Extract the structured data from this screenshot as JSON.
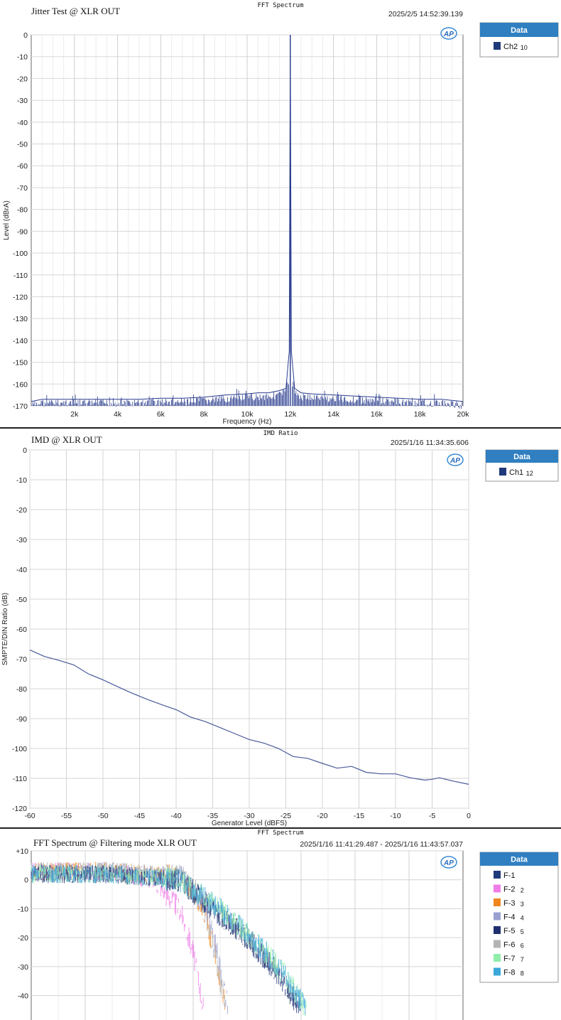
{
  "colors": {
    "trace_navy": "#2a3d8f",
    "imd_line": "#4a5a9a",
    "legend_header": "#2f7fc1",
    "grid": "#d4d4d4"
  },
  "chart_data": [
    {
      "type": "line",
      "window_title": "FFT Spectrum",
      "title": "Jitter Test @ XLR OUT",
      "timestamp": "2025/2/5 14:52:39.139",
      "xlabel": "Frequency (Hz)",
      "ylabel": "Level (dBrA)",
      "xlim": [
        0,
        20000
      ],
      "ylim": [
        -170,
        0
      ],
      "x_ticks": [
        "2k",
        "4k",
        "6k",
        "8k",
        "10k",
        "12k",
        "14k",
        "16k",
        "18k",
        "20k"
      ],
      "x_tick_values": [
        2000,
        4000,
        6000,
        8000,
        10000,
        12000,
        14000,
        16000,
        18000,
        20000
      ],
      "y_ticks": [
        "0",
        "-10",
        "-20",
        "-30",
        "-40",
        "-50",
        "-60",
        "-70",
        "-80",
        "-90",
        "-100",
        "-110",
        "-120",
        "-130",
        "-140",
        "-150",
        "-160",
        "-170"
      ],
      "grid": true,
      "legend_position": "right",
      "legend": {
        "header": "Data",
        "items": [
          {
            "name": "Ch2",
            "index": "10",
            "color": "#1f3a7a"
          }
        ]
      },
      "series": [
        {
          "name": "Ch2",
          "x": [
            0,
            500,
            1000,
            2000,
            3000,
            4000,
            5000,
            6000,
            7000,
            8000,
            9000,
            10000,
            10500,
            11000,
            11500,
            11800,
            11950,
            12000,
            12050,
            12200,
            12500,
            13000,
            14000,
            15000,
            16000,
            17000,
            18000,
            19000,
            20000
          ],
          "y": [
            -168,
            -167,
            -167,
            -167,
            -167,
            -167,
            -167,
            -166.5,
            -166.5,
            -166,
            -165,
            -164.5,
            -164,
            -164,
            -163,
            -162,
            -145,
            0,
            -145,
            -162,
            -164,
            -164.5,
            -165,
            -165.5,
            -166,
            -166.5,
            -167,
            -167,
            -168
          ]
        }
      ],
      "peak": {
        "x": 12000,
        "y": 0
      }
    },
    {
      "type": "line",
      "window_title": "IMD Ratio",
      "title": "IMD @ XLR OUT",
      "timestamp": "2025/1/16 11:34:35.606",
      "xlabel": "Generator Level (dBFS)",
      "ylabel": "SMPTE/DIN Ratio (dB)",
      "xlim": [
        -60,
        0
      ],
      "ylim": [
        -120,
        0
      ],
      "x_ticks": [
        "-60",
        "-55",
        "-50",
        "-45",
        "-40",
        "-35",
        "-30",
        "-25",
        "-20",
        "-15",
        "-10",
        "-5",
        "0"
      ],
      "y_ticks": [
        "0",
        "-10",
        "-20",
        "-30",
        "-40",
        "-50",
        "-60",
        "-70",
        "-80",
        "-90",
        "-100",
        "-110",
        "-120"
      ],
      "grid": true,
      "legend_position": "right",
      "legend": {
        "header": "Data",
        "items": [
          {
            "name": "Ch1",
            "index": "12",
            "color": "#1f3a7a"
          }
        ]
      },
      "series": [
        {
          "name": "Ch1",
          "x": [
            -60,
            -58,
            -56,
            -54,
            -52,
            -50,
            -48,
            -46,
            -44,
            -42,
            -40,
            -38,
            -36,
            -34,
            -32,
            -30,
            -28,
            -26,
            -24,
            -22,
            -20,
            -18,
            -16,
            -14,
            -12,
            -10,
            -8,
            -6,
            -5,
            -4,
            -2,
            0
          ],
          "y": [
            -67,
            -69.2,
            -70.5,
            -72,
            -75,
            -77,
            -79.3,
            -81.5,
            -83.5,
            -85.3,
            -87,
            -89.5,
            -91,
            -93,
            -95,
            -97,
            -98.2,
            -100,
            -102.7,
            -103.3,
            -105,
            -106.6,
            -106,
            -108,
            -108.5,
            -108.5,
            -109.8,
            -110.6,
            -110.3,
            -109.8,
            -111,
            -112
          ]
        }
      ]
    },
    {
      "type": "line",
      "window_title": "FFT Spectrum",
      "title": "FFT Spectrum @ Filtering mode XLR OUT",
      "timestamp": "2025/1/16 11:41:29.487 - 2025/1/16 11:43:57.037",
      "ylim": [
        -45,
        10
      ],
      "y_ticks": [
        "+10",
        "0",
        "-10",
        "-20",
        "-30",
        "-40"
      ],
      "y_tick_values": [
        10,
        0,
        -10,
        -20,
        -30,
        -40
      ],
      "grid": true,
      "legend_position": "right",
      "legend": {
        "header": "Data",
        "items": [
          {
            "name": "F-1",
            "index": "",
            "color": "#1f3a7a"
          },
          {
            "name": "F-2",
            "index": "2",
            "color": "#f07ce8"
          },
          {
            "name": "F-3",
            "index": "3",
            "color": "#f0861e"
          },
          {
            "name": "F-4",
            "index": "4",
            "color": "#9aa0d0"
          },
          {
            "name": "F-5",
            "index": "5",
            "color": "#1f2f70"
          },
          {
            "name": "F-6",
            "index": "6",
            "color": "#b4b4b4"
          },
          {
            "name": "F-7",
            "index": "7",
            "color": "#90eeaa"
          },
          {
            "name": "F-8",
            "index": "8",
            "color": "#3aa8d8"
          }
        ]
      },
      "series": [
        {
          "name": "F-2",
          "color": "#f07ce8",
          "x": [
            0,
            0.3,
            0.45,
            0.55,
            0.6,
            0.64
          ],
          "y": [
            3,
            3,
            0,
            -10,
            -25,
            -45
          ]
        },
        {
          "name": "F-3",
          "color": "#f0861e",
          "x": [
            0,
            0.3,
            0.55,
            0.63,
            0.68,
            0.72
          ],
          "y": [
            3,
            3,
            1,
            -8,
            -25,
            -45
          ]
        },
        {
          "name": "F-4",
          "color": "#9aa0d0",
          "x": [
            0,
            0.3,
            0.56,
            0.64,
            0.69,
            0.73
          ],
          "y": [
            3,
            3,
            1,
            -8,
            -25,
            -45
          ]
        },
        {
          "name": "F-6",
          "color": "#b4b4b4",
          "x": [
            0,
            0.3,
            0.55,
            0.63,
            0.68,
            0.72
          ],
          "y": [
            3,
            3,
            1,
            -6,
            -25,
            -45
          ]
        },
        {
          "name": "F-1",
          "color": "#1f3a7a",
          "x": [
            0,
            0.3,
            0.55,
            0.65,
            0.8,
            0.92,
            1.0
          ],
          "y": [
            2,
            2,
            0,
            -8,
            -20,
            -33,
            -45
          ]
        },
        {
          "name": "F-5",
          "color": "#1f2f70",
          "x": [
            0,
            0.3,
            0.55,
            0.65,
            0.8,
            0.92,
            1.0
          ],
          "y": [
            2,
            2,
            0,
            -8,
            -20,
            -33,
            -45
          ]
        },
        {
          "name": "F-7",
          "color": "#90eeaa",
          "x": [
            0,
            0.3,
            0.55,
            0.67,
            0.82,
            0.94,
            1.02
          ],
          "y": [
            2,
            2,
            0,
            -8,
            -20,
            -33,
            -45
          ]
        },
        {
          "name": "F-8",
          "color": "#3aa8d8",
          "x": [
            0,
            0.3,
            0.55,
            0.67,
            0.82,
            0.94,
            1.02
          ],
          "y": [
            2,
            2,
            0,
            -8,
            -20,
            -33,
            -45
          ]
        }
      ]
    }
  ]
}
